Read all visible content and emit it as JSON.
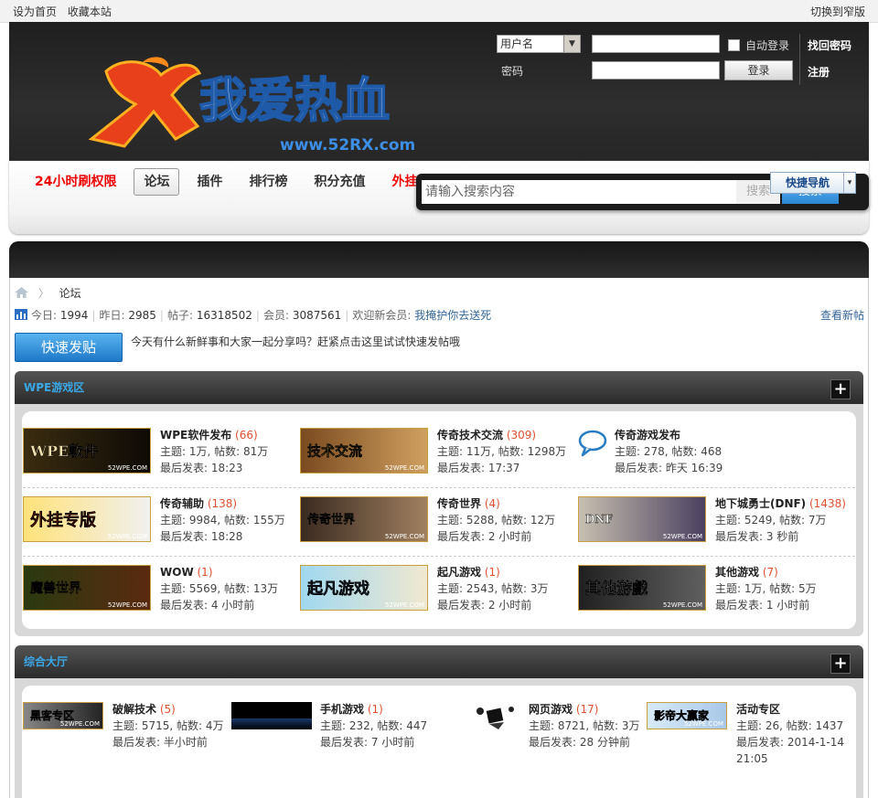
{
  "topbar": {
    "set_home": "设为首页",
    "bookmark": "收藏本站",
    "switch_width": "切换到窄版"
  },
  "logo": {
    "text": "我爱热血",
    "url_text": "www.52RX.com"
  },
  "login": {
    "username_select": "用户名",
    "password_label": "密码",
    "auto_login": "自动登录",
    "login_button": "登录",
    "find_password": "找回密码",
    "register": "注册"
  },
  "nav": {
    "items": [
      {
        "label": "24小时刷权限"
      },
      {
        "label": "论坛"
      },
      {
        "label": "插件"
      },
      {
        "label": "排行榜"
      },
      {
        "label": "积分充值"
      },
      {
        "label": "外挂测试卡卡密兑换"
      }
    ],
    "search_placeholder": "请输入搜索内容",
    "search_type": "搜索",
    "search_button": "搜索",
    "quick_nav": "快捷导航"
  },
  "breadcrumb": {
    "current": "论坛"
  },
  "stats": {
    "today_label": "今日:",
    "today": "1994",
    "yesterday_label": "昨日:",
    "yesterday": "2985",
    "posts_label": "帖子:",
    "posts": "16318502",
    "members_label": "会员:",
    "members": "3087561",
    "welcome_label": "欢迎新会员:",
    "newest_member": "我掩护你去送死",
    "new_posts_link": "查看新帖"
  },
  "quick_post": {
    "button": "快速发贴",
    "hint": "今天有什么新鲜事和大家一起分享吗？赶紧点击这里试试快速发帖哦"
  },
  "categories": [
    {
      "title": "WPE游戏区",
      "forums": [
        {
          "name": "WPE软件发布",
          "count": "(66)",
          "stats": "主题: 1万, 帖数: 81万",
          "last": "最后发表: 18:23",
          "thumb_text": "WPE軟件"
        },
        {
          "name": "传奇技术交流",
          "count": "(309)",
          "stats": "主题: 11万, 帖数: 1298万",
          "last": "最后发表: 17:37",
          "thumb_text": "技术交流"
        },
        {
          "name": "传奇游戏发布",
          "count": "",
          "stats": "主题: 278, 帖数: 468",
          "last": "最后发表: 昨天 16:39",
          "thumb_text": ""
        },
        {
          "name": "传奇辅助",
          "count": "(138)",
          "stats": "主题: 9984, 帖数: 155万",
          "last": "最后发表: 18:28",
          "thumb_text": "外挂专版"
        },
        {
          "name": "传奇世界",
          "count": "(4)",
          "stats": "主题: 5288, 帖数: 12万",
          "last": "最后发表: 2 小时前",
          "thumb_text": "传奇世界"
        },
        {
          "name": "地下城勇士(DNF)",
          "count": "(1438)",
          "stats": "主题: 5249, 帖数: 7万",
          "last": "最后发表: 3 秒前",
          "thumb_text": "DNF"
        },
        {
          "name": "WOW",
          "count": "(1)",
          "stats": "主题: 5569, 帖数: 13万",
          "last": "最后发表: 4 小时前",
          "thumb_text": "魔兽世界"
        },
        {
          "name": "起凡游戏",
          "count": "(1)",
          "stats": "主题: 2543, 帖数: 3万",
          "last": "最后发表: 2 小时前",
          "thumb_text": "起凡游戏"
        },
        {
          "name": "其他游戏",
          "count": "(7)",
          "stats": "主题: 1万, 帖数: 5万",
          "last": "最后发表: 1 小时前",
          "thumb_text": "其他游戲"
        }
      ]
    },
    {
      "title": "综合大厅",
      "forums": [
        {
          "name": "破解技术",
          "count": "(5)",
          "stats": "主题: 5715, 帖数: 4万",
          "last": "最后发表: 半小时前",
          "thumb_text": "黑客专区"
        },
        {
          "name": "手机游戏",
          "count": "(1)",
          "stats": "主题: 232, 帖数: 447",
          "last": "最后发表: 7 小时前",
          "thumb_text": ""
        },
        {
          "name": "网页游戏",
          "count": "(17)",
          "stats": "主题: 8721, 帖数: 3万",
          "last": "最后发表: 28 分钟前",
          "thumb_text": ""
        },
        {
          "name": "活动专区",
          "count": "",
          "stats": "主题: 26, 帖数: 1437",
          "last": "最后发表: 2014-1-14",
          "last2": "21:05",
          "thumb_text": "影帝大赢家"
        }
      ]
    }
  ],
  "thumb_watermark": "52WPE.COM",
  "colors": {
    "header_bg": "#262626",
    "nav_red": "#ee0000",
    "category_title": "#3aa8e8",
    "count": "#e05030",
    "link_blue": "#336699",
    "quick_post_blue": "#1e78c8"
  }
}
